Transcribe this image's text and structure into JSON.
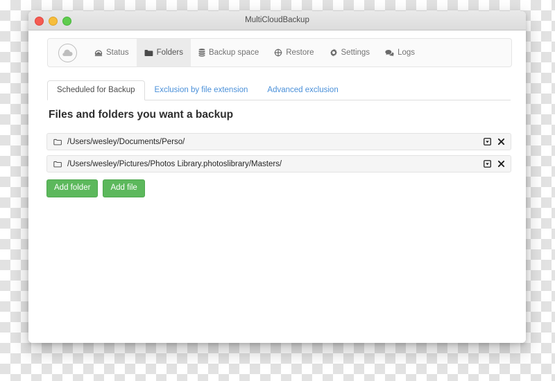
{
  "window": {
    "title": "MultiCloudBackup",
    "traffic_lights": [
      "close",
      "minimize",
      "maximize"
    ]
  },
  "navbar": {
    "brand_icon": "cloud-icon",
    "items": [
      {
        "label": "Status",
        "icon": "dashboard-icon",
        "active": false
      },
      {
        "label": "Folders",
        "icon": "folder-icon",
        "active": true
      },
      {
        "label": "Backup space",
        "icon": "database-icon",
        "active": false
      },
      {
        "label": "Restore",
        "icon": "crosshair-icon",
        "active": false
      },
      {
        "label": "Settings",
        "icon": "gear-icon",
        "active": false
      },
      {
        "label": "Logs",
        "icon": "comments-icon",
        "active": false
      }
    ]
  },
  "tabs": [
    {
      "label": "Scheduled for Backup",
      "active": true
    },
    {
      "label": "Exclusion by file extension",
      "active": false
    },
    {
      "label": "Advanced exclusion",
      "active": false
    }
  ],
  "main": {
    "heading": "Files and folders you want a backup",
    "rows": [
      {
        "path": "/Users/wesley/Documents/Perso/",
        "icon": "folder-outline-icon",
        "actions": [
          "box-chevron-down-icon",
          "close-icon"
        ]
      },
      {
        "path": "/Users/wesley/Pictures/Photos Library.photoslibrary/Masters/",
        "icon": "folder-outline-icon",
        "actions": [
          "box-chevron-down-icon",
          "close-icon"
        ]
      }
    ],
    "buttons": [
      {
        "label": "Add folder"
      },
      {
        "label": "Add file"
      }
    ]
  },
  "colors": {
    "accent_link": "#4a90d9",
    "button_green": "#5cb85c",
    "row_background": "#f5f5f5",
    "navbar_background": "#fafafa"
  }
}
